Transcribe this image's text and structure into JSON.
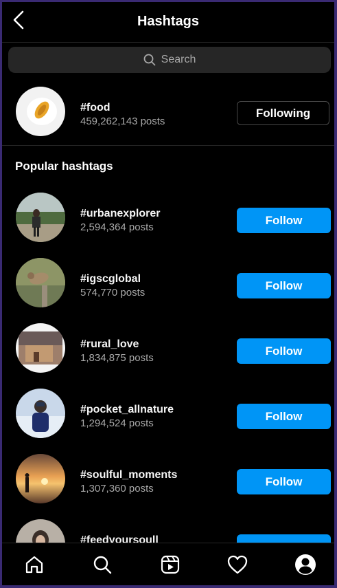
{
  "header": {
    "title": "Hashtags"
  },
  "search": {
    "placeholder": "Search"
  },
  "following_tag": {
    "name": "#food",
    "posts": "459,262,143 posts",
    "button": "Following"
  },
  "section": {
    "title": "Popular hashtags"
  },
  "popular": [
    {
      "name": "#urbanexplorer",
      "posts": "2,594,364 posts",
      "button": "Follow"
    },
    {
      "name": "#igscglobal",
      "posts": "574,770 posts",
      "button": "Follow"
    },
    {
      "name": "#rural_love",
      "posts": "1,834,875 posts",
      "button": "Follow"
    },
    {
      "name": "#pocket_allnature",
      "posts": "1,294,524 posts",
      "button": "Follow"
    },
    {
      "name": "#soulful_moments",
      "posts": "1,307,360 posts",
      "button": "Follow"
    },
    {
      "name": "#feedyoursoull",
      "posts": "",
      "button": "Follow"
    }
  ],
  "nav": [
    "home-icon",
    "search-icon",
    "reels-icon",
    "heart-icon",
    "profile-icon"
  ],
  "colors": {
    "accent": "#0095f6",
    "background": "#000000",
    "secondary_text": "#a8a8a8"
  }
}
